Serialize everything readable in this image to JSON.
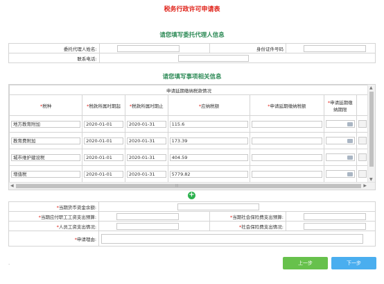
{
  "page_title": "税务行政许可申请表",
  "agent_section": {
    "title": "请您填写委托代理人信息",
    "name_label": "委托代理人姓名:",
    "name_value": "",
    "id_label": "身份证件号码",
    "id_value": "",
    "phone_label": "联系电话:",
    "phone_value": ""
  },
  "matter_section": {
    "title": "请您填写事项相关信息",
    "table_caption": "申请延期缴纳税款情况",
    "columns": [
      {
        "label": "税种",
        "required": true
      },
      {
        "label": "税款所属时期起",
        "required": true
      },
      {
        "label": "税款所属时期止",
        "required": true
      },
      {
        "label": "应纳税额",
        "required": true
      },
      {
        "label": "申请延期缴纳税额",
        "required": true
      },
      {
        "label": "申请延期缴纳期限",
        "required": true
      }
    ],
    "rows": [
      {
        "tax_type": "地方教育附加",
        "start": "2020-01-01",
        "end": "2020-01-31",
        "amount": "115.6",
        "deferred_amount": "",
        "deadline": ""
      },
      {
        "tax_type": "教育费附加",
        "start": "2020-01-01",
        "end": "2020-01-31",
        "amount": "173.39",
        "deferred_amount": "",
        "deadline": ""
      },
      {
        "tax_type": "城市维护建设税",
        "start": "2020-01-01",
        "end": "2020-01-31",
        "amount": "404.59",
        "deferred_amount": "",
        "deadline": ""
      },
      {
        "tax_type": "增值税",
        "start": "2020-01-01",
        "end": "2020-01-31",
        "amount": "5779.82",
        "deferred_amount": "",
        "deadline": ""
      }
    ],
    "add_symbol": "+",
    "scroll_grip": "⦙⦙⦙"
  },
  "extra": {
    "cash_balance_label": "当期货币资金余额:",
    "cash_balance_value": "",
    "payroll_budget_label": "当期应付职工工资支出预算:",
    "payroll_budget_value": "",
    "social_budget_label": "当期社会保险费支出预算:",
    "social_budget_value": "",
    "staff_pay_label": "人员工资支出情况:",
    "staff_pay_value": "",
    "social_pay_label": "社会保险费支出情况:",
    "social_pay_value": "",
    "reason_label": "申请理由:",
    "reason_value": ""
  },
  "buttons": {
    "prev": "上一步",
    "next": "下一步"
  },
  "footer_dot": "."
}
